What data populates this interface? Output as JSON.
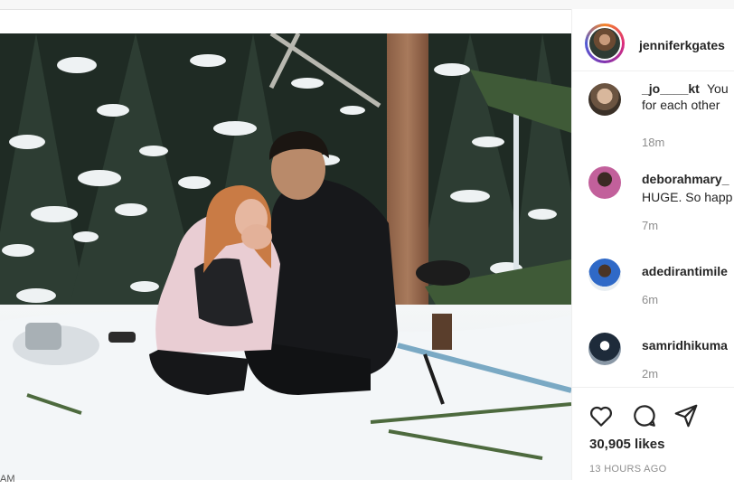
{
  "post": {
    "username": "jenniferkgates",
    "likes": "30,905 likes",
    "time_ago": "13 HOURS AGO"
  },
  "comments": [
    {
      "user": "_jo____kt",
      "text_line1": "You",
      "text_line2": "for each other",
      "time": "18m"
    },
    {
      "user": "deborahmary_",
      "text_line1": "HUGE. So happ",
      "time": "7m"
    },
    {
      "user": "adedirantimile",
      "time": "6m"
    },
    {
      "user": "samridhikuma",
      "time": "2m"
    }
  ],
  "icons": {
    "like": "heart-icon",
    "comment": "comment-icon",
    "share": "share-icon"
  },
  "colors": {
    "text": "#262626",
    "muted": "#8e8e8e",
    "divider": "#efefef"
  },
  "corner_label": "AM"
}
